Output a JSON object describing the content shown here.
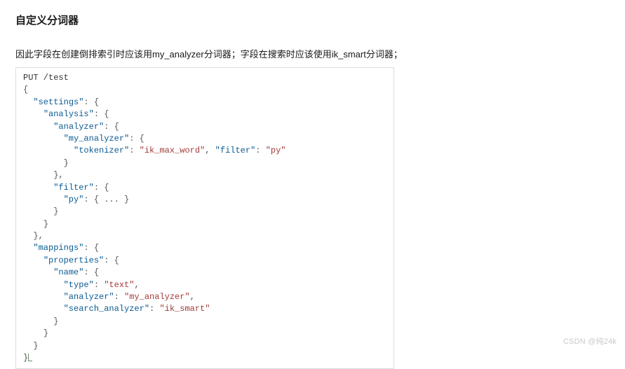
{
  "heading": "自定义分词器",
  "description": "因此字段在创建倒排索引时应该用my_analyzer分词器；字段在搜索时应该使用ik_smart分词器；",
  "watermark": "CSDN @纯24k",
  "code": {
    "line1": "PUT /test",
    "settings_key": "\"settings\"",
    "analysis_key": "\"analysis\"",
    "analyzer_key": "\"analyzer\"",
    "my_analyzer_key": "\"my_analyzer\"",
    "tokenizer_key": "\"tokenizer\"",
    "tokenizer_val": "\"ik_max_word\"",
    "filter_inline_key": "\"filter\"",
    "filter_inline_val": "\"py\"",
    "filter_key": "\"filter\"",
    "py_key": "\"py\"",
    "py_val": "{ ... }",
    "mappings_key": "\"mappings\"",
    "properties_key": "\"properties\"",
    "name_key": "\"name\"",
    "type_key": "\"type\"",
    "type_val": "\"text\"",
    "analyzer2_key": "\"analyzer\"",
    "analyzer2_val": "\"my_analyzer\"",
    "search_analyzer_key": "\"search_analyzer\"",
    "search_analyzer_val": "\"ik_smart\""
  }
}
